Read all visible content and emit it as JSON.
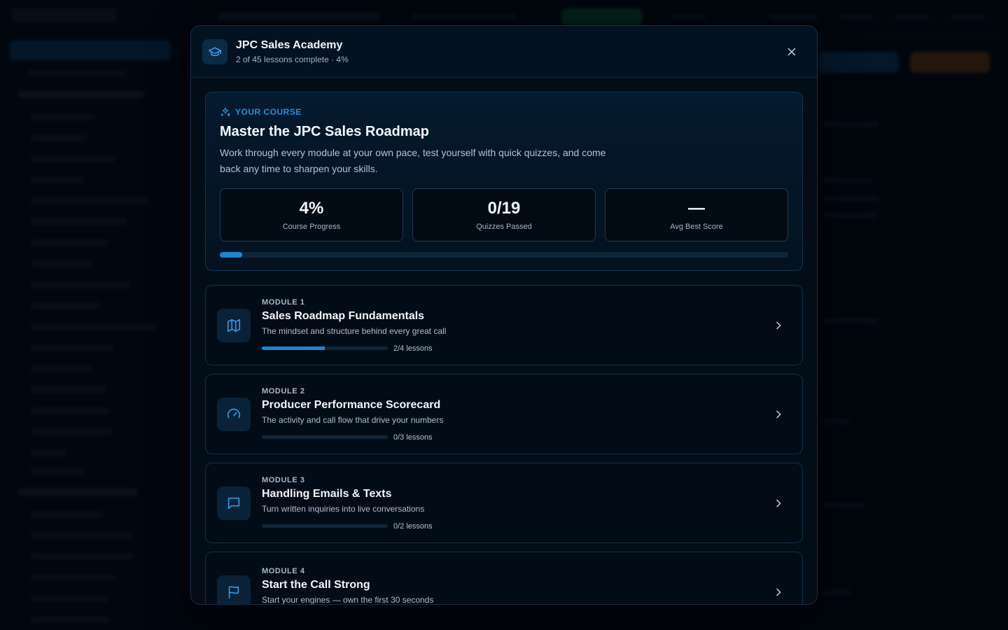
{
  "modal": {
    "title": "JPC Sales Academy",
    "subtitle": "2 of 45 lessons complete · 4%",
    "icons": {
      "header": "graduation-cap-icon",
      "close": "close-icon"
    }
  },
  "course": {
    "eyebrow": "YOUR COURSE",
    "eyebrow_icon": "sparkles-icon",
    "title": "Master the JPC Sales Roadmap",
    "description": "Work through every module at your own pace, test yourself with quick quizzes, and come back any time to sharpen your skills.",
    "stats": [
      {
        "value": "4%",
        "label": "Course Progress"
      },
      {
        "value": "0/19",
        "label": "Quizzes Passed"
      },
      {
        "value": "—",
        "label": "Avg Best Score"
      }
    ],
    "progress_fraction": 0.04
  },
  "modules": [
    {
      "number": "MODULE 1",
      "title": "Sales Roadmap Fundamentals",
      "description": "The mindset and structure behind every great call",
      "progress_label": "2/4 lessons",
      "progress_fraction": 0.5,
      "icon": "map-icon"
    },
    {
      "number": "MODULE 2",
      "title": "Producer Performance Scorecard",
      "description": "The activity and call flow that drive your numbers",
      "progress_label": "0/3 lessons",
      "progress_fraction": 0,
      "icon": "gauge-icon"
    },
    {
      "number": "MODULE 3",
      "title": "Handling Emails & Texts",
      "description": "Turn written inquiries into live conversations",
      "progress_label": "0/2 lessons",
      "progress_fraction": 0,
      "icon": "message-square-icon"
    },
    {
      "number": "MODULE 4",
      "title": "Start the Call Strong",
      "description": "Start your engines — own the first 30 seconds",
      "progress_label": "",
      "progress_fraction": 0,
      "icon": "flag-icon"
    }
  ],
  "colors": {
    "accent": "#1b86d0",
    "eyebrow": "#2a8fd6",
    "icon_stroke": "#2f9be0",
    "modal_bg": "#020d18"
  }
}
